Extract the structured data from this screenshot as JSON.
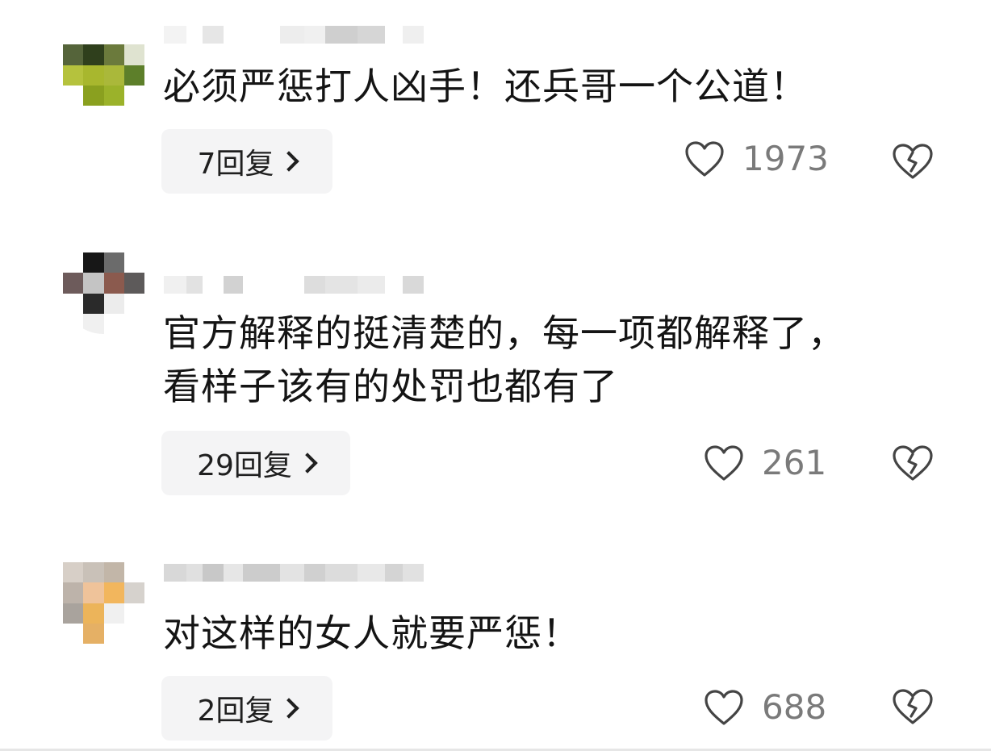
{
  "comments": [
    {
      "text": "必须严惩打人凶手！还兵哥一个公道！",
      "reply_label": "7回复",
      "likes": "1973",
      "avatar_colors": [
        "#ffffff",
        "#ffffff",
        "#ffffff",
        "#ffffff",
        "#55643a",
        "#2f3f1c",
        "#6b7a3c",
        "#dfe3d0",
        "#b5c23d",
        "#a8b72e",
        "#aab83a",
        "#5d7f2a",
        "#ffffff",
        "#8aa01f",
        "#9bb22a",
        "#ffffff"
      ],
      "name_blocks": [
        "#f3f3f3",
        "#ffffff",
        "#e6e6e6",
        "#ffffff",
        "#ffffff",
        "#ededed",
        "#f0f0f0",
        "#cfcfcf",
        "#d6d6d6",
        "#ffffff",
        "#efefef"
      ]
    },
    {
      "text": "官方解释的挺清楚的，每一项都解释了，看样子该有的处罚也都有了",
      "reply_label": "29回复",
      "likes": "261",
      "avatar_colors": [
        "#ffffff",
        "#171717",
        "#6b6b6b",
        "#ffffff",
        "#6d5b5b",
        "#c4c4c4",
        "#8b5a4e",
        "#5d5a5a",
        "#ffffff",
        "#2a2a2a",
        "#ececec",
        "#ffffff",
        "#ffffff",
        "#f0f0f0",
        "#ffffff",
        "#ffffff"
      ],
      "name_blocks": [
        "#f0f0f0",
        "#e2e2e2",
        "#ffffff",
        "#d2d2d2",
        "#ffffff",
        "#ffffff",
        "#dddddd",
        "#e4e4e4",
        "#ebebeb",
        "#ffffff",
        "#d9d9d9"
      ]
    },
    {
      "text": "对这样的女人就要严惩！",
      "reply_label": "2回复",
      "likes": "688",
      "avatar_colors": [
        "#d7cfc7",
        "#c9c1b8",
        "#c2b6a8",
        "#ffffff",
        "#bdb3aa",
        "#efc39a",
        "#f2b65d",
        "#d6d2cd",
        "#a9a39d",
        "#ecb45a",
        "#f0f0f0",
        "#ffffff",
        "#ffffff",
        "#e5b065",
        "#ffffff",
        "#ffffff"
      ],
      "name_blocks": [
        "#d8d8d8",
        "#e0e0e0",
        "#c8c8c8",
        "#e6e6e6",
        "#cccccc",
        "#e3e3e3",
        "#d0d0d0",
        "#dcdcdc",
        "#e8e8e8",
        "#d4d4d4",
        "#e1e1e1"
      ]
    }
  ]
}
